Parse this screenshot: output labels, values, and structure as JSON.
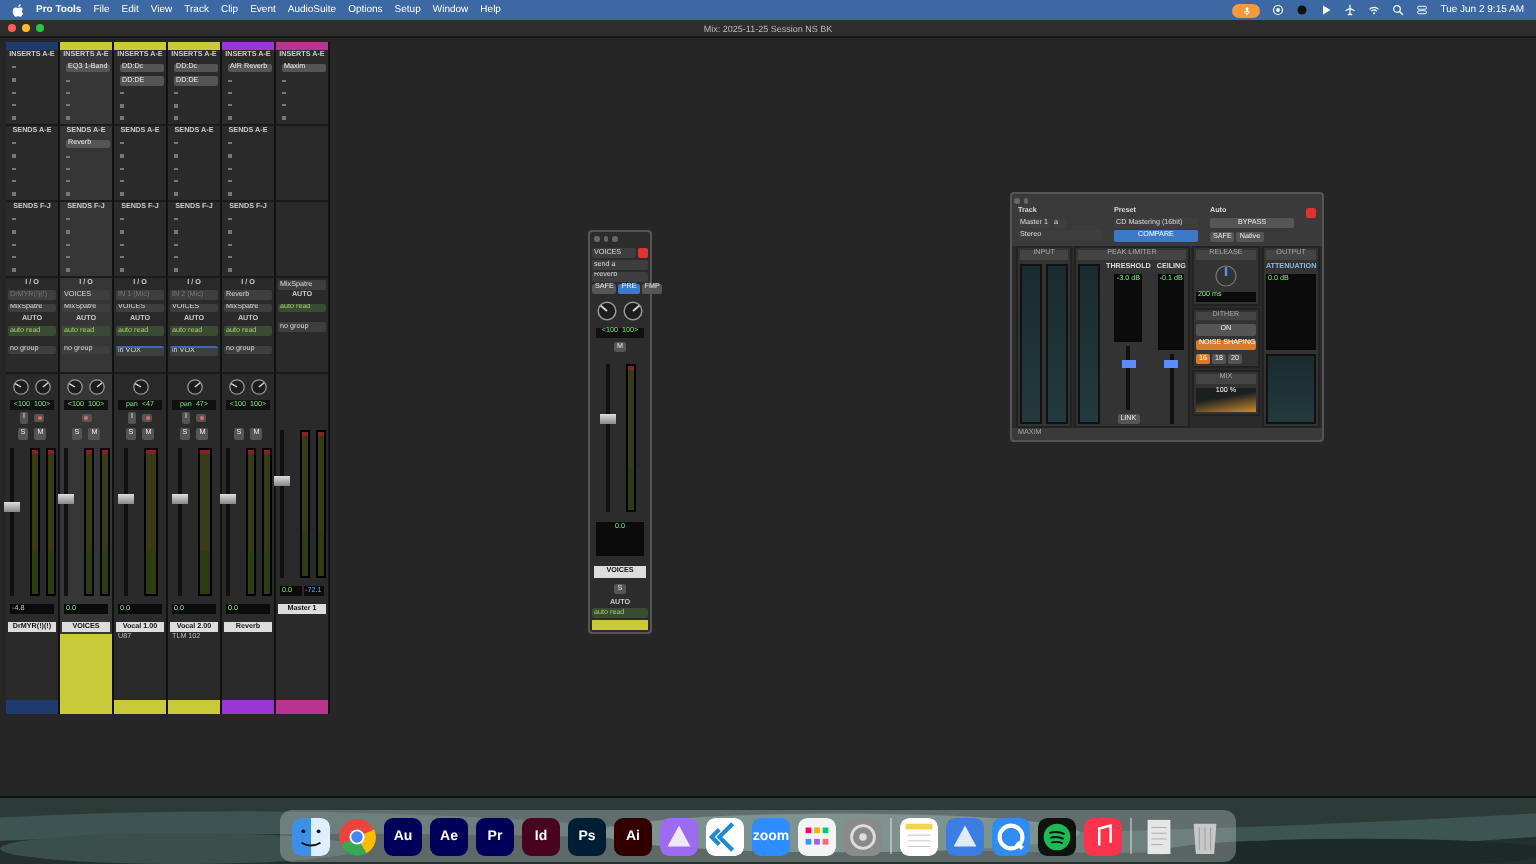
{
  "menu_bar": {
    "app": "Pro Tools",
    "items": [
      "File",
      "Edit",
      "View",
      "Track",
      "Clip",
      "Event",
      "AudioSuite",
      "Options",
      "Setup",
      "Window",
      "Help"
    ],
    "clock": "Tue Jun 2  9:15 AM"
  },
  "window": {
    "title": "Mix: 2025-11-25 Session NS BK"
  },
  "strips": [
    {
      "name": "DrMYR(!)(!)",
      "color": "#1f3a6e",
      "selected": false,
      "kind": "audio",
      "stereo": true,
      "headers": {
        "inserts": "INSERTS A-E",
        "sends_ae": "SENDS A-E",
        "sends_fj": "SENDS F-J",
        "io": "I / O",
        "auto": "AUTO"
      },
      "input": "DrMYR(!)(!)",
      "output": "MixSpatre",
      "automation": "auto read",
      "group": "no group",
      "pan": [
        "<100",
        "100>"
      ],
      "buttons": [
        "I",
        "S",
        "M"
      ],
      "level": 0.6,
      "readouts": [
        "-4.8"
      ]
    },
    {
      "name": "VOICES",
      "color": "#c9c93a",
      "selected": true,
      "kind": "audio",
      "stereo": true,
      "headers": {
        "inserts": "INSERTS A-E",
        "sends_ae": "SENDS A-E",
        "sends_fj": "SENDS F-J",
        "io": "I / O",
        "auto": "AUTO"
      },
      "inserts": [
        "EQ3 1-Band"
      ],
      "sends": [
        "Reverb"
      ],
      "input": "VOICES",
      "output": "MixSpatre",
      "automation": "auto read",
      "group": "no group",
      "pan": [
        "<100",
        "100>"
      ],
      "buttons": [
        "S",
        "M"
      ],
      "level": 0.65,
      "readouts": [
        "0.0"
      ]
    },
    {
      "name": "Vocal 1.00",
      "comment": "U87",
      "color": "#c9c93a",
      "selected": false,
      "kind": "audio",
      "stereo": false,
      "headers": {
        "inserts": "INSERTS A-E",
        "sends_ae": "SENDS A-E",
        "sends_fj": "SENDS F-J",
        "io": "I / O",
        "auto": "AUTO"
      },
      "inserts": [
        "DD:Dc",
        "DD:DE"
      ],
      "input": "IN 1 (Mic)",
      "output": "VOICES",
      "automation": "auto read",
      "group": "in VOX",
      "pan": [
        "pan",
        "<47"
      ],
      "buttons": [
        "I",
        "S",
        "M"
      ],
      "level": 0.65,
      "readouts": [
        "0.0"
      ]
    },
    {
      "name": "Vocal 2.00",
      "comment": "TLM 102",
      "color": "#c9c93a",
      "selected": false,
      "kind": "audio",
      "stereo": false,
      "headers": {
        "inserts": "INSERTS A-E",
        "sends_ae": "SENDS A-E",
        "sends_fj": "SENDS F-J",
        "io": "I / O",
        "auto": "AUTO"
      },
      "inserts": [
        "DD:Dc",
        "DD:DE"
      ],
      "input": "IN 2 (Mic)",
      "output": "VOICES",
      "automation": "auto read",
      "group": "in VOX",
      "pan": [
        "pan",
        "47>"
      ],
      "buttons": [
        "I",
        "S",
        "M"
      ],
      "level": 0.65,
      "readouts": [
        "0.0"
      ]
    },
    {
      "name": "Reverb",
      "color": "#9a35d6",
      "selected": false,
      "kind": "aux",
      "stereo": true,
      "headers": {
        "inserts": "INSERTS A-E",
        "sends_ae": "SENDS A-E",
        "sends_fj": "SENDS F-J",
        "io": "I / O",
        "auto": "AUTO"
      },
      "inserts": [
        "AIR Reverb"
      ],
      "input": "Reverb",
      "output": "MixSpatre",
      "automation": "auto read",
      "group": "no group",
      "pan": [
        "<100",
        "100>"
      ],
      "buttons": [
        "S",
        "M"
      ],
      "level": 0.65,
      "readouts": [
        "0.0"
      ]
    },
    {
      "name": "Master 1",
      "color": "#b8348f",
      "selected": false,
      "kind": "master",
      "stereo": true,
      "headers": {
        "inserts": "INSERTS A-E",
        "auto": "AUTO"
      },
      "inserts": [
        "Maxim"
      ],
      "output": "MixSpatre",
      "automation": "auto read",
      "group": "no group",
      "level": 0.65,
      "readouts": [
        "0.0",
        "-72.1"
      ]
    }
  ],
  "floating_strip": {
    "track": "VOICES",
    "send": "send a",
    "destination": "Reverb",
    "modes": [
      "SAFE",
      "PRE",
      "FMP"
    ],
    "pan": [
      "<100",
      "100>"
    ],
    "buttons": [
      "M",
      "S"
    ],
    "level": 0.62,
    "readout": "0.0",
    "name": "VOICES",
    "auto": "AUTO",
    "automation": "auto read",
    "color": "#c9c93a"
  },
  "plugin": {
    "labels": [
      "Track",
      "Preset",
      "Auto"
    ],
    "track": "Master 1",
    "insert": "a",
    "format": "Stereo",
    "preset": "CD Mastering (16bit)",
    "compare": "COMPARE",
    "bypass": "BYPASS",
    "safe": "SAFE",
    "native": "Native",
    "sections": [
      "INPUT",
      "PEAK LIMITER",
      "RELEASE",
      "OUTPUT"
    ],
    "threshold_label": "THRESHOLD",
    "ceiling_label": "CEILING",
    "threshold": {
      "value": "-3.0 dB",
      "level": 0.72
    },
    "ceiling": {
      "value": "-0.1 dB",
      "level": 0.85
    },
    "release": "200 ms",
    "dither_label": "DITHER",
    "dither_on": "ON",
    "noise_shaping": "NOISE SHAPING",
    "bits": [
      {
        "label": "16",
        "selected": true
      },
      {
        "label": "18",
        "selected": false
      },
      {
        "label": "20",
        "selected": false
      }
    ],
    "mix_label": "MIX",
    "mix": "100 %",
    "attenuation_label": "ATTENUATION",
    "attenuation": "0.0 dB",
    "link": "LINK",
    "footer": "MAXIM"
  },
  "dock": [
    {
      "kind": "finder",
      "color": "#3d8fe8"
    },
    {
      "kind": "chrome",
      "color": "#e8453c"
    },
    {
      "kind": "tile",
      "label": "Au",
      "color": "#00005b"
    },
    {
      "kind": "tile",
      "label": "Ae",
      "color": "#00005b"
    },
    {
      "kind": "tile",
      "label": "Pr",
      "color": "#00005b"
    },
    {
      "kind": "tile",
      "label": "Id",
      "color": "#49021f"
    },
    {
      "kind": "tile",
      "label": "Ps",
      "color": "#001e36"
    },
    {
      "kind": "tile",
      "label": "Ai",
      "color": "#330000"
    },
    {
      "kind": "app",
      "color": "#9b6cf0"
    },
    {
      "kind": "code",
      "color": "#ffffff"
    },
    {
      "kind": "tile",
      "label": "zoom",
      "color": "#2d8cff"
    },
    {
      "kind": "grid",
      "color": "#f4f4f4"
    },
    {
      "kind": "gear",
      "color": "#8a8a8a"
    },
    {
      "kind": "divider"
    },
    {
      "kind": "notes",
      "color": "#ffffff"
    },
    {
      "kind": "app",
      "color": "#3b7de0"
    },
    {
      "kind": "quicktime",
      "color": "#2f8cf0"
    },
    {
      "kind": "spotify",
      "color": "#1db954"
    },
    {
      "kind": "music",
      "color": "#f9344c"
    },
    {
      "kind": "divider"
    },
    {
      "kind": "document",
      "color": "#e6e6e6"
    },
    {
      "kind": "trash",
      "color": "#c8c8c8"
    }
  ]
}
